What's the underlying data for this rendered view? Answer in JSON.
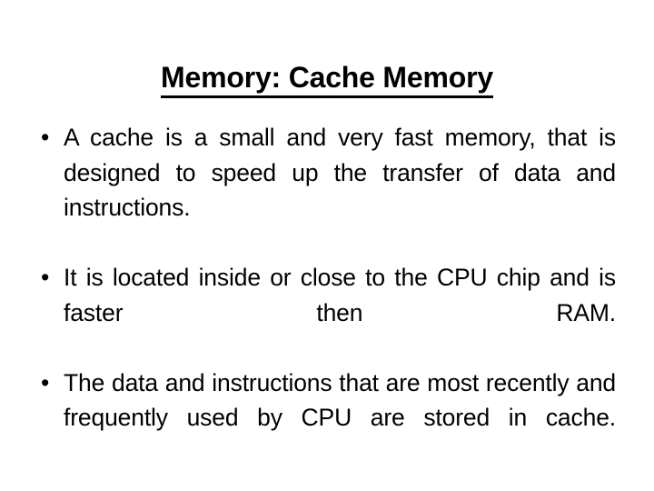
{
  "slide": {
    "background_color": "#ffffff",
    "text_color": "#000000",
    "title": "Memory: Cache Memory",
    "bullets": [
      {
        "marker": "•",
        "text": "A cache is a small and very fast memory, that is designed to speed up the transfer of data and instructions."
      },
      {
        "marker": "•",
        "text": "It is located inside or close to the CPU chip and is faster then RAM."
      },
      {
        "marker": "•",
        "text": "The data and instructions that are most recently and frequently used by CPU are stored in cache."
      }
    ]
  }
}
